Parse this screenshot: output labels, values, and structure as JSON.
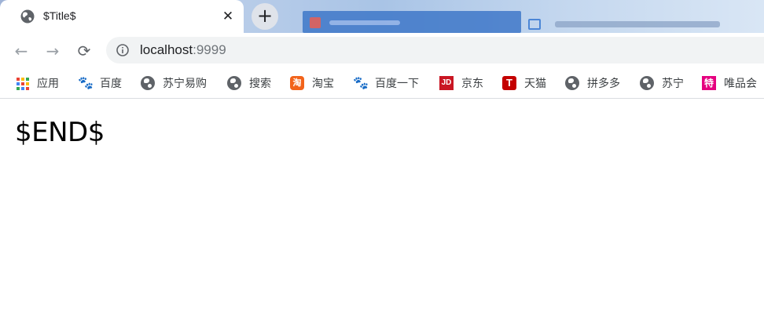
{
  "tab": {
    "title": "$Title$",
    "close_glyph": "✕",
    "favicon": "globe-icon"
  },
  "new_tab_glyph": "+",
  "toolbar": {
    "back_glyph": "←",
    "forward_glyph": "→",
    "reload_glyph": "⟳",
    "url_host": "localhost",
    "url_port": ":9999"
  },
  "bookmarks": [
    {
      "label": "应用",
      "icon": "apps-grid-icon",
      "glyph": ""
    },
    {
      "label": "百度",
      "icon": "baidu-paw-icon",
      "glyph": "🐾"
    },
    {
      "label": "苏宁易购",
      "icon": "globe-icon",
      "glyph": ""
    },
    {
      "label": "搜索",
      "icon": "globe-icon",
      "glyph": ""
    },
    {
      "label": "淘宝",
      "icon": "taobao-icon",
      "glyph": "淘"
    },
    {
      "label": "百度一下",
      "icon": "baidu-paw-icon",
      "glyph": "🐾"
    },
    {
      "label": "京东",
      "icon": "jd-icon",
      "glyph": "JD"
    },
    {
      "label": "天猫",
      "icon": "tmall-icon",
      "glyph": "T"
    },
    {
      "label": "拼多多",
      "icon": "globe-icon",
      "glyph": ""
    },
    {
      "label": "苏宁",
      "icon": "globe-icon",
      "glyph": ""
    },
    {
      "label": "唯品会",
      "icon": "vip-icon",
      "glyph": "特"
    }
  ],
  "colors": {
    "apps_grid": [
      "#ea4335",
      "#fbbc05",
      "#34a853",
      "#4285f4",
      "#ea4335",
      "#fbbc05",
      "#34a853",
      "#4285f4",
      "#ea4335"
    ]
  },
  "page": {
    "heading": "$END$"
  }
}
